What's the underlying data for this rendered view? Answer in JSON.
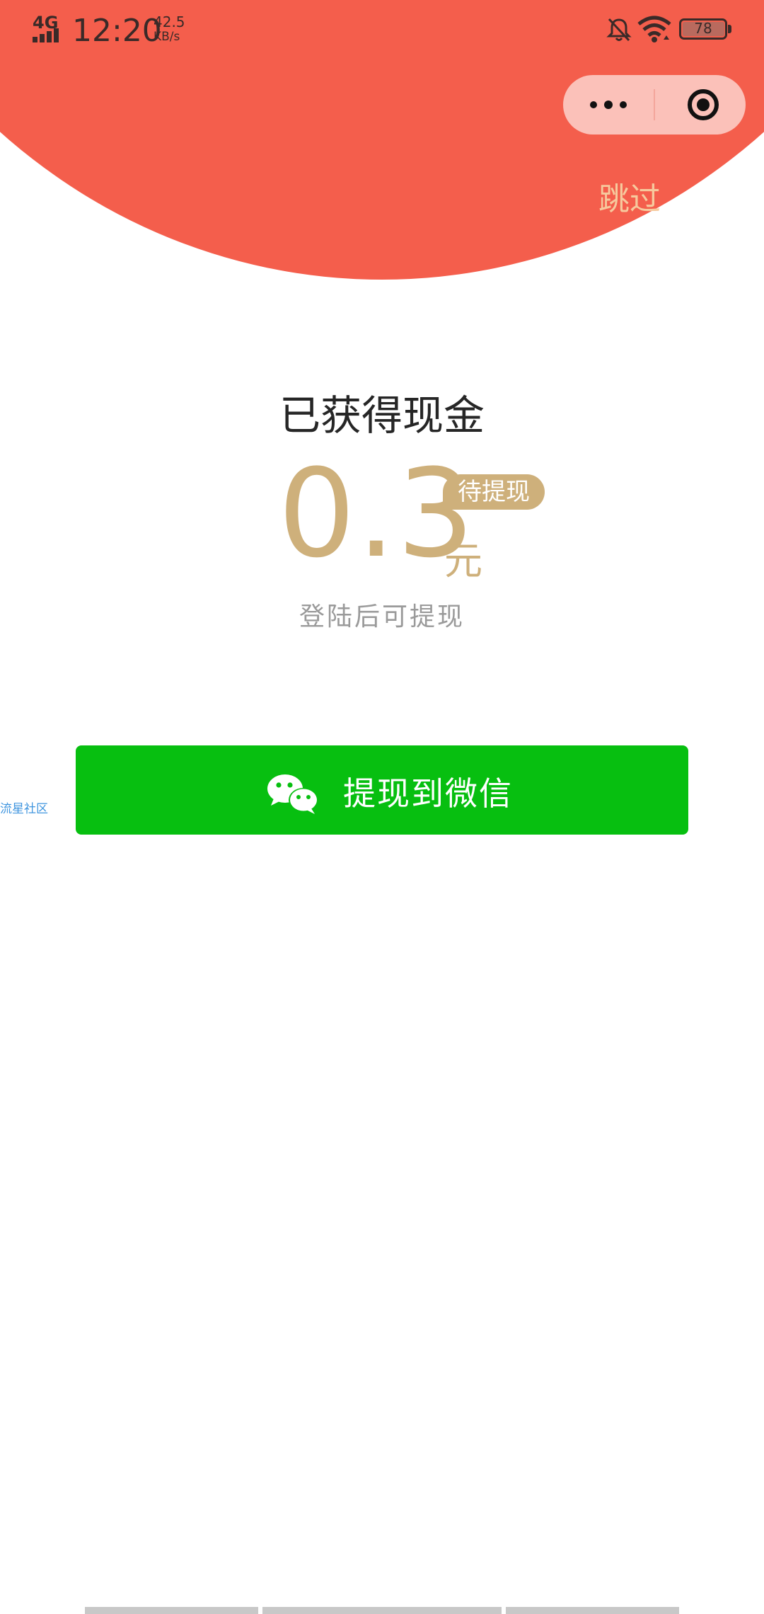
{
  "status_bar": {
    "network_type": "4G",
    "time": "12:20",
    "net_speed_value": "42.5",
    "net_speed_unit": "KB/s",
    "battery_level": "78",
    "icons": [
      "signal-icon",
      "mute-bell-icon",
      "wifi-icon",
      "battery-icon"
    ]
  },
  "capsule": {
    "icons": [
      "more-dots-icon",
      "close-target-icon"
    ]
  },
  "header": {
    "skip_label": "跳过",
    "accent_color": "#f45e4c",
    "skip_color": "#f6c99d"
  },
  "reward": {
    "title": "已获得现金",
    "amount": "0.3",
    "badge": "待提现",
    "unit": "元",
    "hint": "登陆后可提现",
    "gold_color": "#ceb07b"
  },
  "side_label": "流星社区",
  "withdraw": {
    "label": "提现到微信",
    "icon": "wechat-icon",
    "color": "#07bf10"
  }
}
